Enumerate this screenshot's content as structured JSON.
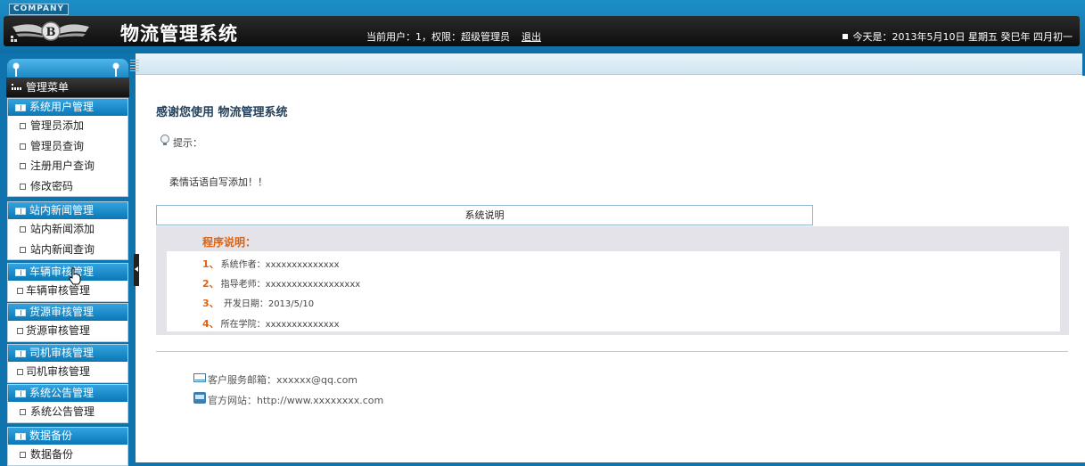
{
  "header": {
    "company": "COMPANY",
    "title": "物流管理系统",
    "user_info": "当前用户：1，权限：超级管理员",
    "logout": "退出",
    "date": "今天是：2013年5月10日 星期五 癸巳年 四月初一"
  },
  "sidebar": {
    "menu_title": "管理菜单",
    "groups": [
      {
        "title": "系统用户管理",
        "items": [
          "管理员添加",
          "管理员查询",
          "注册用户查询",
          "修改密码"
        ]
      },
      {
        "title": "站内新闻管理",
        "items": [
          "站内新闻添加",
          "站内新闻查询"
        ]
      },
      {
        "title": "车辆审核管理",
        "items": [
          "车辆审核管理"
        ]
      },
      {
        "title": "货源审核管理",
        "items": [
          "货源审核管理"
        ]
      },
      {
        "title": "司机审核管理",
        "items": [
          "司机审核管理"
        ]
      },
      {
        "title": "系统公告管理",
        "items": [
          "系统公告管理"
        ]
      },
      {
        "title": "数据备份",
        "items": [
          "数据备份"
        ]
      }
    ]
  },
  "main": {
    "welcome": "感谢您使用 物流管理系统",
    "hint_label": "提示：",
    "custom_text": "柔情话语自写添加！！",
    "sys_header": "系统说明",
    "program_title": "程序说明：",
    "program_lines": [
      {
        "num": "1、",
        "text": "系统作者：xxxxxxxxxxxxxx"
      },
      {
        "num": "2、",
        "text": "指导老师：xxxxxxxxxxxxxxxxxx"
      },
      {
        "num": "3、",
        "text": "  开发日期：2013/5/10"
      },
      {
        "num": "4、",
        "text": "所在学院：xxxxxxxxxxxxxx"
      }
    ],
    "email_label": "客户服务邮箱：xxxxxx@qq.com",
    "website_label": "官方网站：http://www.xxxxxxxx.com"
  },
  "colors": {
    "header_blue": "#1d8fc7",
    "sidebar_blue": "#0f73ad",
    "accent_orange": "#e0620f"
  },
  "icons": [
    "bentley-logo-icon",
    "menu-grid-icon",
    "group-book-icon",
    "item-square-icon",
    "lightbulb-icon",
    "mail-icon",
    "website-icon",
    "hand-cursor-icon"
  ]
}
